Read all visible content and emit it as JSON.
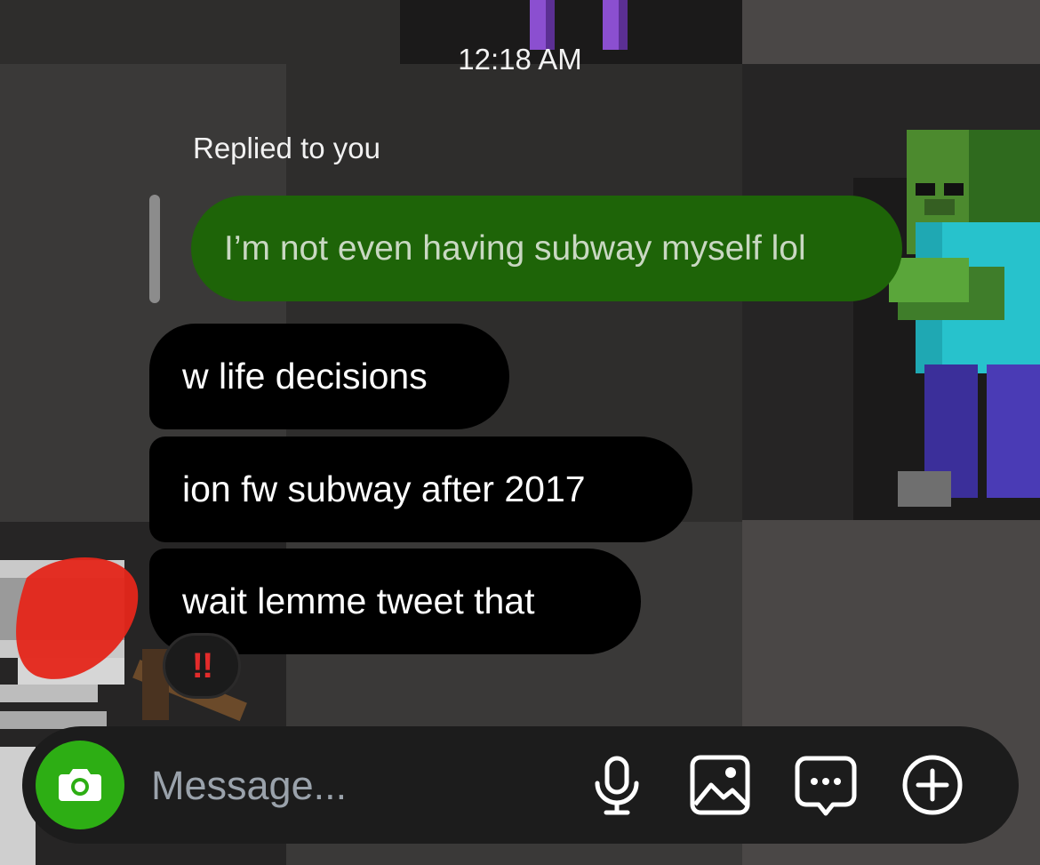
{
  "chat": {
    "timestamp": "12:18 AM",
    "reply_label": "Replied to you",
    "quoted_message": "I’m not even having subway myself lol",
    "messages": [
      {
        "text": "w life decisions"
      },
      {
        "text": "ion fw subway after 2017"
      },
      {
        "text": "wait lemme tweet that"
      }
    ],
    "reaction": "!!"
  },
  "composer": {
    "placeholder": "Message...",
    "icons": [
      "camera-icon",
      "microphone-icon",
      "gallery-icon",
      "sticker-chat-icon",
      "plus-circle-icon"
    ]
  },
  "colors": {
    "quoted_bubble": "#1e6408",
    "message_bubble": "#000000",
    "camera_button": "#2dae14",
    "reaction": "#e32b2b"
  }
}
